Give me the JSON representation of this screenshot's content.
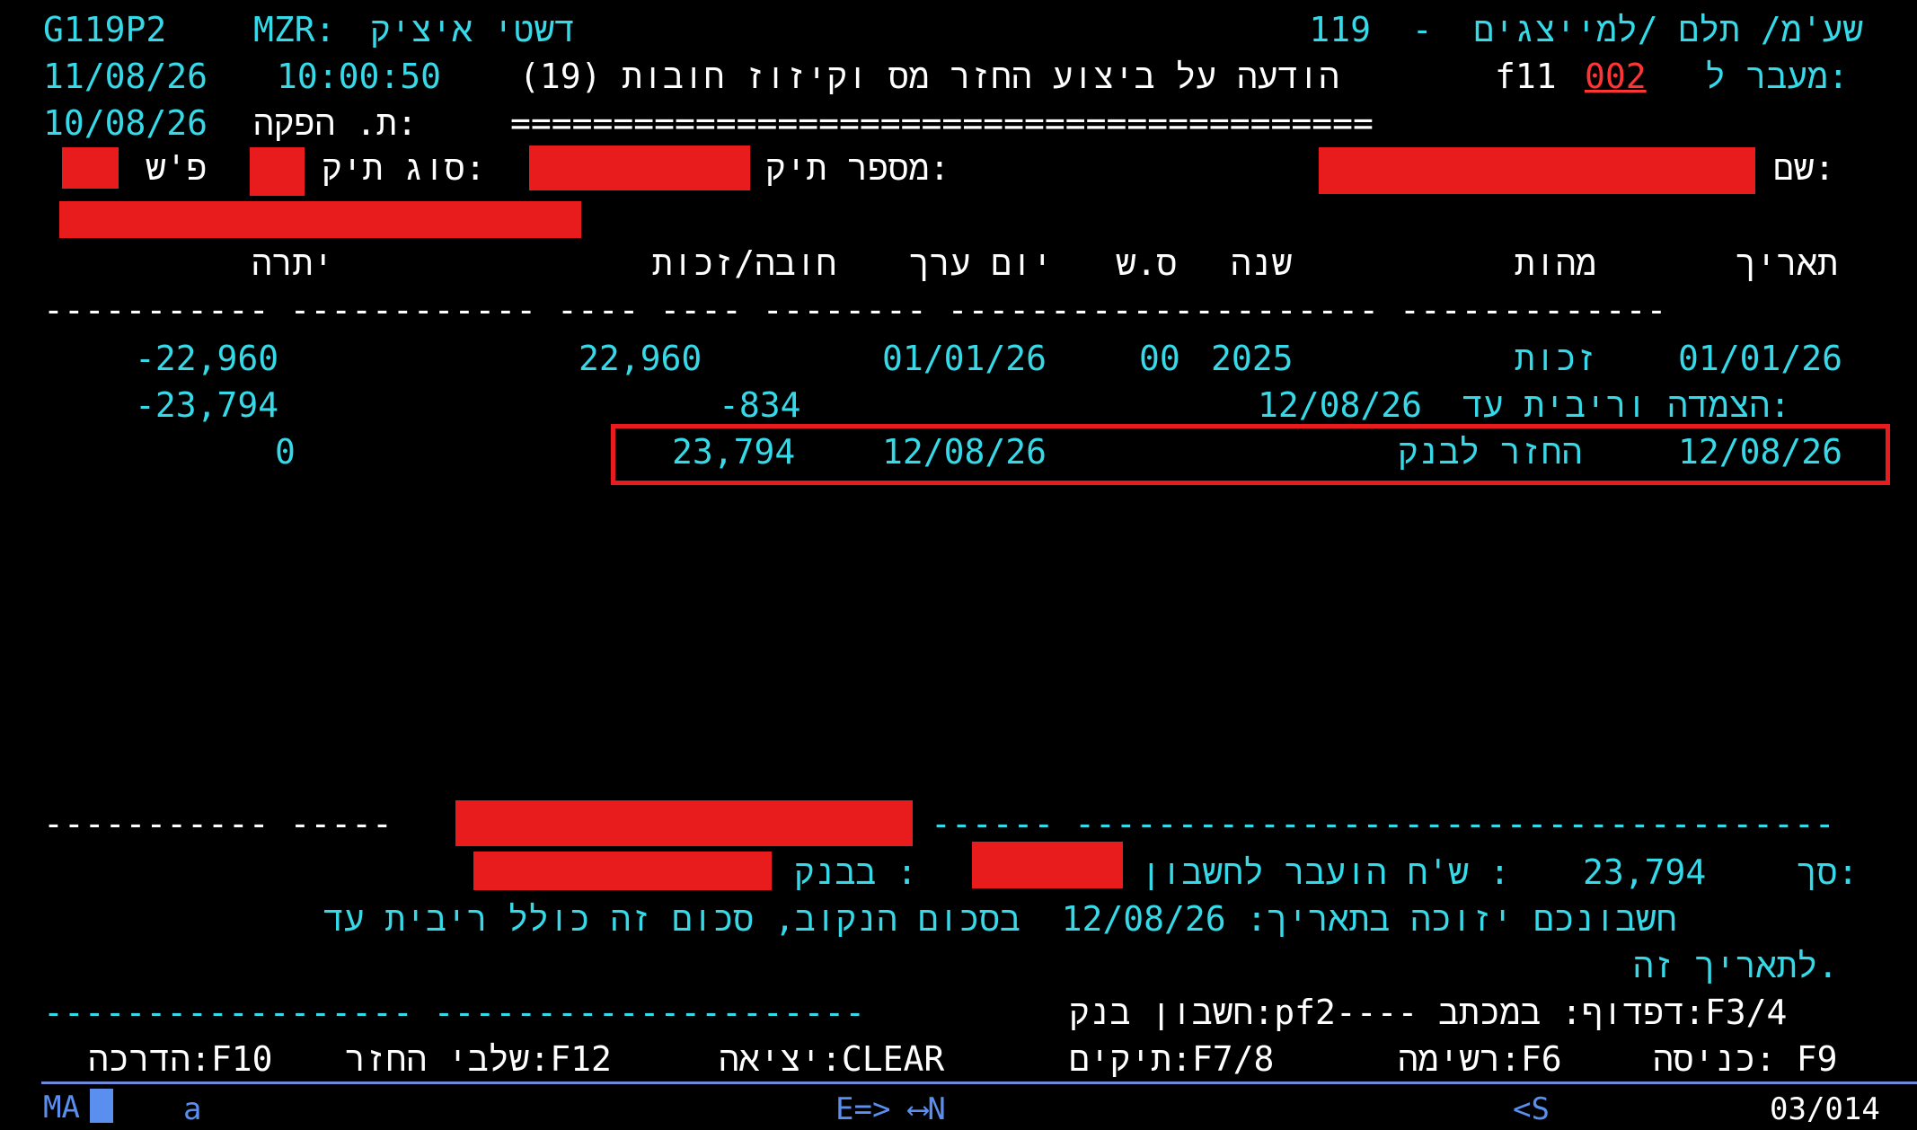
{
  "header": {
    "program_id": "G119P2",
    "mzr_label": "MZR:",
    "clerk_name": "דשטי איציק",
    "title": "שע'מ/ תלם /למייצגים  -  119",
    "date": "11/08/26",
    "time": "10:00:50",
    "notice_title": "(19) הודעה על ביצוע החזר מס וקיזוז חובות",
    "transfer_label": "מעבר ל:",
    "transfer_prefix": "f11",
    "transfer_code": "002",
    "issue_date_label": "ת. הפקה:",
    "issue_date": "10/08/26",
    "separator_line": "=========================================="
  },
  "file_info": {
    "name_label": "שם:",
    "file_number_label": "מספר תיק:",
    "file_type_label": "סוג תיק:",
    "ps_label": "פ'ש"
  },
  "table": {
    "columns": {
      "date": "תאריך",
      "nature": "מהות",
      "year": "שנה",
      "ss": "ס.ש",
      "value_day": "יום ערך",
      "debit_credit": "חובה/זכות",
      "balance": "יתרה"
    },
    "dashes": "----------- ------------ ---- ---- -------- --------------------- -------------",
    "rows": [
      {
        "date": "01/01/26",
        "nature": "זכות",
        "year": "2025",
        "ss": "00",
        "value_day": "01/01/26",
        "amount": "22,960",
        "balance": "-22,960"
      },
      {
        "linkage_label": "הצמדה וריבית עד:",
        "linkage_date": "12/08/26",
        "amount": "-834",
        "balance": "-23,794"
      },
      {
        "date": "12/08/26",
        "nature": "החזר לבנק",
        "value_day": "12/08/26",
        "amount": "23,794",
        "balance": "0"
      }
    ]
  },
  "summary": {
    "dash_left": "----------- -----",
    "dash_right": "------ -------------------------------------",
    "total_label": "סך:",
    "total_amount": "23,794",
    "transferred_text": "ש'ח הועבר לחשבון :",
    "bank_label": "בבנק :",
    "credit_line": "חשבונכם יזוכה בתאריך: 12/08/26  בסכום הנקוב, סכום זה כולל ריבית עד",
    "credit_line_2": "לתאריך זה."
  },
  "footer": {
    "nav_line": "חשבון בנק:pf2---- דפדוף: במכתב:F3/4",
    "nav_dashes": "------------------ ---------------------",
    "keys": {
      "entry": "כניסה: F9",
      "list": "רשימה:F6",
      "files": "תיקים:F7/8",
      "exit": "יציאה:CLEAR",
      "refund_stages": "שלבי החזר:F12",
      "guide": "הדרכה:F10"
    }
  },
  "status": {
    "ma": "MA",
    "a_under": "A",
    "input_char": "a",
    "mode": "E=> ⟷N",
    "s_indicator": "<S",
    "cursor_pos": "03/014"
  },
  "colors": {
    "background": "#000000",
    "text_cyan": "#36d9e8",
    "text_white": "#ffffff",
    "text_red": "#ff3434",
    "redaction": "#e81c1c"
  }
}
